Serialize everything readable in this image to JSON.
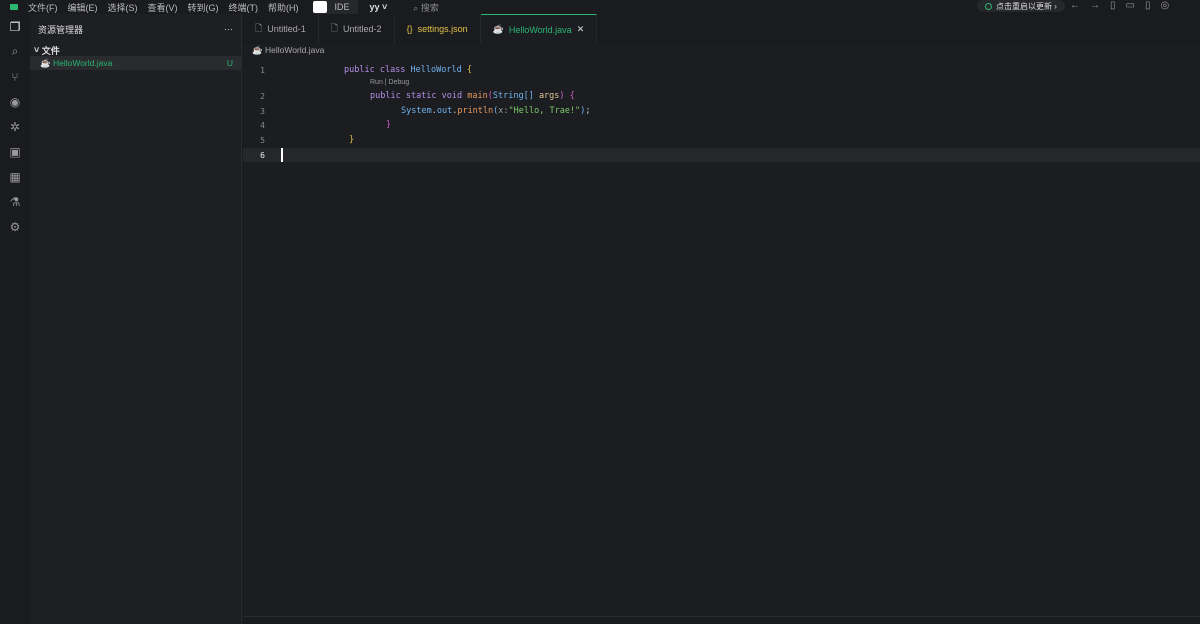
{
  "menu": [
    "文件(F)",
    "编辑(E)",
    "选择(S)",
    "查看(V)",
    "转到(G)",
    "终端(T)",
    "帮助(H)"
  ],
  "ide_label": "IDE",
  "user": "yy",
  "search_placeholder": "搜索",
  "update_label": "点击重启以更新",
  "sidebar": {
    "title": "资源管理器",
    "more": "···",
    "folder": "文件",
    "file": "HelloWorld.java",
    "file_status": "U"
  },
  "tabs": [
    {
      "label": "Untitled-1",
      "icon": "file-icon"
    },
    {
      "label": "Untitled-2",
      "icon": "file-icon"
    },
    {
      "label": "settings.json",
      "icon": "json-icon"
    },
    {
      "label": "HelloWorld.java",
      "icon": "java-icon"
    }
  ],
  "breadcrumb": "HelloWorld.java",
  "codelens": "Run | Debug",
  "line_numbers": [
    "1",
    "2",
    "3",
    "4",
    "5",
    "6"
  ],
  "code": {
    "l1": [
      "public ",
      "class ",
      "HelloWorld ",
      "{"
    ],
    "l2": [
      "public ",
      "static ",
      "void ",
      "main",
      "(",
      "String",
      "[] ",
      "args",
      ") ",
      "{"
    ],
    "l3": [
      "System",
      ".",
      "out",
      ".",
      "println",
      "(",
      "x:",
      "\"Hello, Trae!\"",
      ")",
      ";"
    ],
    "l4": "}",
    "l5": "}"
  },
  "colors": {
    "accent": "#2bb673",
    "background": "#1c1d20"
  }
}
